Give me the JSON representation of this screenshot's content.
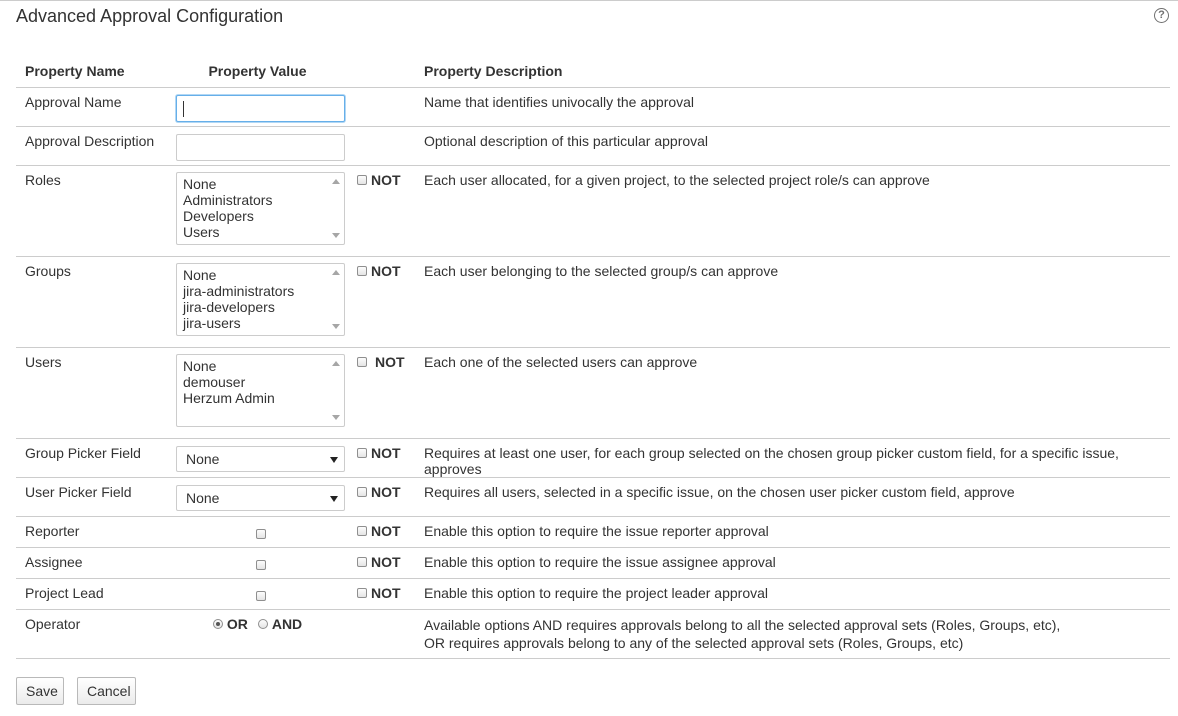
{
  "page": {
    "title": "Advanced Approval Configuration",
    "help_icon": "question-circle-icon"
  },
  "table": {
    "headers": {
      "name": "Property Name",
      "value": "Property Value",
      "description": "Property Description"
    },
    "not_label": "NOT",
    "rows": {
      "approval_name": {
        "label": "Approval Name",
        "value": "",
        "description": "Name that identifies univocally the approval"
      },
      "approval_description": {
        "label": "Approval Description",
        "value": "",
        "description": "Optional description of this particular approval"
      },
      "roles": {
        "label": "Roles",
        "options": [
          "None",
          "Administrators",
          "Developers",
          "Users"
        ],
        "not_checked": false,
        "description": "Each user allocated, for a given project, to the selected project role/s can approve"
      },
      "groups": {
        "label": "Groups",
        "options": [
          "None",
          "jira-administrators",
          "jira-developers",
          "jira-users"
        ],
        "not_checked": false,
        "description": "Each user belonging to the selected group/s can approve"
      },
      "users": {
        "label": "Users",
        "options": [
          "None",
          "demouser",
          "Herzum Admin"
        ],
        "not_checked": false,
        "description": "Each one of the selected users can approve"
      },
      "group_picker_field": {
        "label": "Group Picker Field",
        "selected": "None",
        "not_checked": false,
        "description": "Requires at least one user, for each group selected on the chosen group picker custom field, for a specific issue, approves"
      },
      "user_picker_field": {
        "label": "User Picker Field",
        "selected": "None",
        "not_checked": false,
        "description": "Requires all users, selected in a specific issue, on the chosen user picker custom field, approve"
      },
      "reporter": {
        "label": "Reporter",
        "checked": false,
        "not_checked": false,
        "description": "Enable this option to require the issue reporter approval"
      },
      "assignee": {
        "label": "Assignee",
        "checked": false,
        "not_checked": false,
        "description": "Enable this option to require the issue assignee approval"
      },
      "project_lead": {
        "label": "Project Lead",
        "checked": false,
        "not_checked": false,
        "description": "Enable this option to require the project leader approval"
      },
      "operator": {
        "label": "Operator",
        "or_label": "OR",
        "and_label": "AND",
        "selected": "OR",
        "description_line1": "Available options AND requires approvals belong to all the selected approval sets (Roles, Groups, etc),",
        "description_line2": "OR requires approvals belong to any of the selected approval sets (Roles, Groups, etc)"
      }
    }
  },
  "buttons": {
    "save": "Save",
    "cancel": "Cancel"
  }
}
